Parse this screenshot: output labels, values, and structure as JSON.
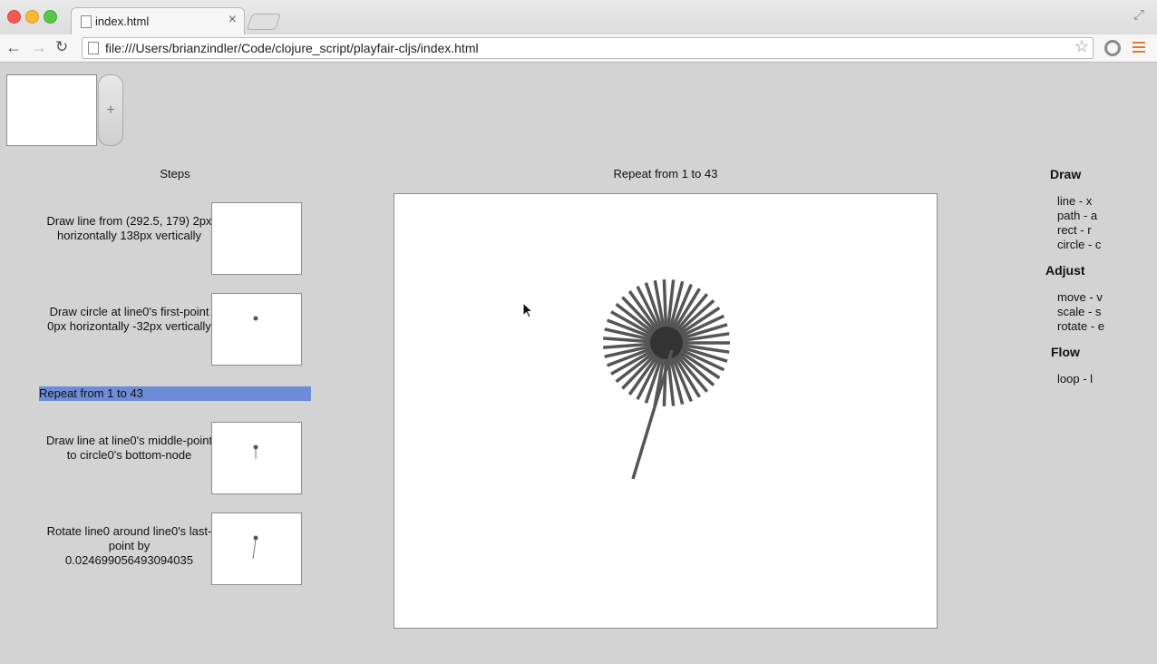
{
  "browser": {
    "tab_title": "index.html",
    "url": "file:///Users/brianzindler/Code/clojure_script/playfair-cljs/index.html"
  },
  "app": {
    "add_label": "+",
    "steps_heading": "Steps",
    "steps": [
      {
        "text": "Draw line from (292.5, 179) 2px horizontally 138px vertically"
      },
      {
        "text": "Draw circle at line0's first-point 0px horizontally -32px vertically"
      },
      {
        "text": "Repeat from 1 to 43",
        "selected": true
      },
      {
        "text": "Draw line at line0's middle-point to circle0's bottom-node"
      },
      {
        "text": "Rotate line0 around line0's last-point by 0.024699056493094035"
      }
    ],
    "canvas_title": "Repeat from 1 to 43",
    "colors": {
      "selection": "#6d8dd8",
      "stroke": "#555555"
    }
  },
  "tools": {
    "draw": {
      "heading": "Draw",
      "items": [
        "line - x",
        "path - a",
        "rect - r",
        "circle - c"
      ]
    },
    "adjust": {
      "heading": "Adjust",
      "items": [
        "move - v",
        "scale - s",
        "rotate - e"
      ]
    },
    "flow": {
      "heading": "Flow",
      "items": [
        "loop - l"
      ]
    }
  }
}
